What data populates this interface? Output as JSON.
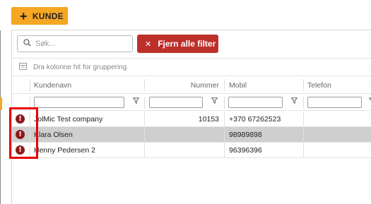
{
  "toolbar": {
    "add_label": "KUNDE",
    "add_icon": "plus-icon"
  },
  "filters": {
    "search_placeholder": "Søk...",
    "search_value": "",
    "clear_label": "Fjern alle filter"
  },
  "grouping": {
    "hint": "Dra kolonne hit for gruppering"
  },
  "columns": [
    {
      "label": "Kundenavn"
    },
    {
      "label": "Nummer"
    },
    {
      "label": "Mobil"
    },
    {
      "label": "Telefon"
    }
  ],
  "rows": [
    {
      "status_icon": "alert-icon",
      "name": "JolMic Test company",
      "number": "10153",
      "mobile": "+370 67262523",
      "phone": "",
      "selected": false
    },
    {
      "status_icon": "alert-icon",
      "name": "Klara Olsen",
      "number": "",
      "mobile": "98989898",
      "phone": "",
      "selected": true
    },
    {
      "status_icon": "alert-icon",
      "name": "Henny Pedersen 2",
      "number": "",
      "mobile": "96396396",
      "phone": "",
      "selected": false
    }
  ],
  "colors": {
    "accent": "#f5a623",
    "danger": "#bd2f2a",
    "alert": "#8b1a1a",
    "selected_row": "#cfcfcf",
    "highlight": "#e60000"
  }
}
